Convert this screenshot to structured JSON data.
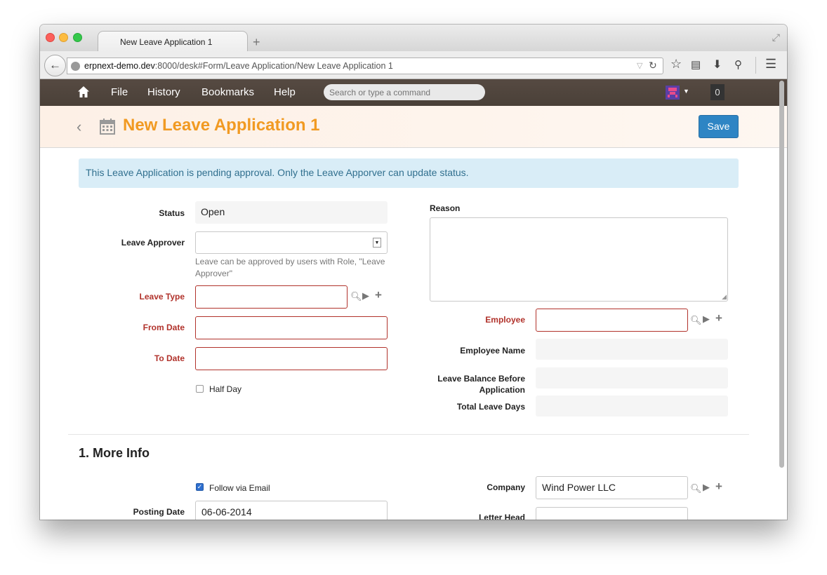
{
  "browser": {
    "tab_title": "New Leave Application 1",
    "url_host": "erpnext-demo.dev",
    "url_path": ":8000/desk#Form/Leave Application/New Leave Application 1"
  },
  "appnav": {
    "menus": [
      "File",
      "History",
      "Bookmarks",
      "Help"
    ],
    "search_placeholder": "Search or type a command",
    "notifications": "0"
  },
  "page": {
    "title": "New Leave Application 1",
    "save_label": "Save",
    "alert": "This Leave Application is pending approval. Only the Leave Apporver can update status."
  },
  "form": {
    "status_label": "Status",
    "status_value": "Open",
    "approver_label": "Leave Approver",
    "approver_help": "Leave can be approved by users with Role, \"Leave Approver\"",
    "leave_type_label": "Leave Type",
    "from_date_label": "From Date",
    "to_date_label": "To Date",
    "half_day_label": "Half Day",
    "reason_label": "Reason",
    "employee_label": "Employee",
    "employee_name_label": "Employee Name",
    "leave_balance_label": "Leave Balance Before Application",
    "total_leave_days_label": "Total Leave Days"
  },
  "more_info": {
    "section_title": "1. More Info",
    "follow_email_label": "Follow via Email",
    "posting_date_label": "Posting Date",
    "posting_date_value": "06-06-2014",
    "company_label": "Company",
    "company_value": "Wind Power LLC",
    "letter_head_label": "Letter Head"
  }
}
